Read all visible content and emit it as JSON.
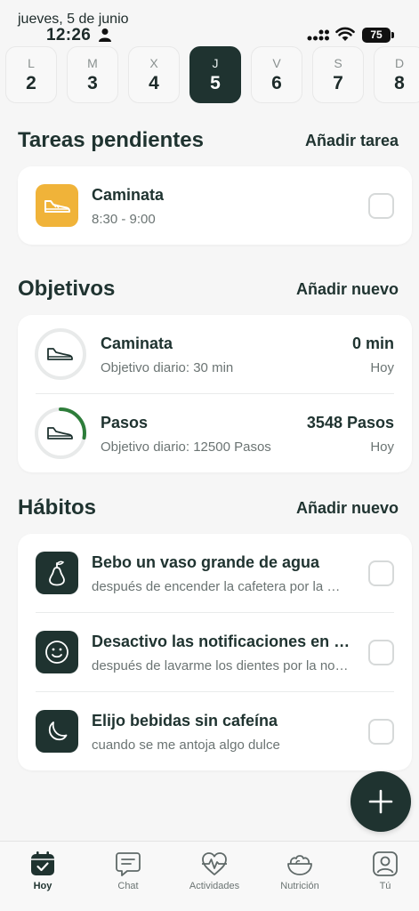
{
  "status_bar": {
    "date": "jueves, 5 de junio",
    "time": "12:26",
    "battery": "75"
  },
  "week": [
    {
      "letter": "L",
      "number": "2"
    },
    {
      "letter": "M",
      "number": "3"
    },
    {
      "letter": "X",
      "number": "4"
    },
    {
      "letter": "J",
      "number": "5",
      "selected": true
    },
    {
      "letter": "V",
      "number": "6"
    },
    {
      "letter": "S",
      "number": "7"
    },
    {
      "letter": "D",
      "number": "8"
    }
  ],
  "tasks": {
    "title": "Tareas pendientes",
    "action": "Añadir tarea",
    "items": [
      {
        "title": "Caminata",
        "time": "8:30 - 9:00",
        "icon": "sneaker-icon",
        "icon_color": "#f0b339"
      }
    ]
  },
  "goals": {
    "title": "Objetivos",
    "action": "Añadir nuevo",
    "items": [
      {
        "title": "Caminata",
        "subtitle": "Objetivo diario: 30 min",
        "value": "0 min",
        "date": "Hoy",
        "progress": 0.0
      },
      {
        "title": "Pasos",
        "subtitle": "Objetivo diario: 12500 Pasos",
        "value": "3548 Pasos",
        "date": "Hoy",
        "progress": 0.28
      }
    ]
  },
  "habits": {
    "title": "Hábitos",
    "action": "Añadir nuevo",
    "items": [
      {
        "title": "Bebo un vaso grande de agua",
        "subtitle": "después de encender la cafetera por la mañana",
        "icon": "pear-icon"
      },
      {
        "title": "Desactivo las notificaciones en el móvil",
        "subtitle": "después de lavarme los dientes por la noche",
        "icon": "smiley-icon"
      },
      {
        "title": "Elijo bebidas sin cafeína",
        "subtitle": "cuando se me antoja algo dulce",
        "icon": "moon-icon"
      }
    ]
  },
  "tabbar": {
    "tabs": [
      {
        "label": "Hoy",
        "icon": "calendar-check-icon",
        "active": true
      },
      {
        "label": "Chat",
        "icon": "chat-icon"
      },
      {
        "label": "Actividades",
        "icon": "heart-pulse-icon"
      },
      {
        "label": "Nutrición",
        "icon": "salad-bowl-icon"
      },
      {
        "label": "Tú",
        "icon": "profile-icon"
      }
    ]
  },
  "colors": {
    "primary": "#1f3330",
    "accent": "#f0b339",
    "progress": "#2e7d3a",
    "background": "#f6f6f6"
  }
}
